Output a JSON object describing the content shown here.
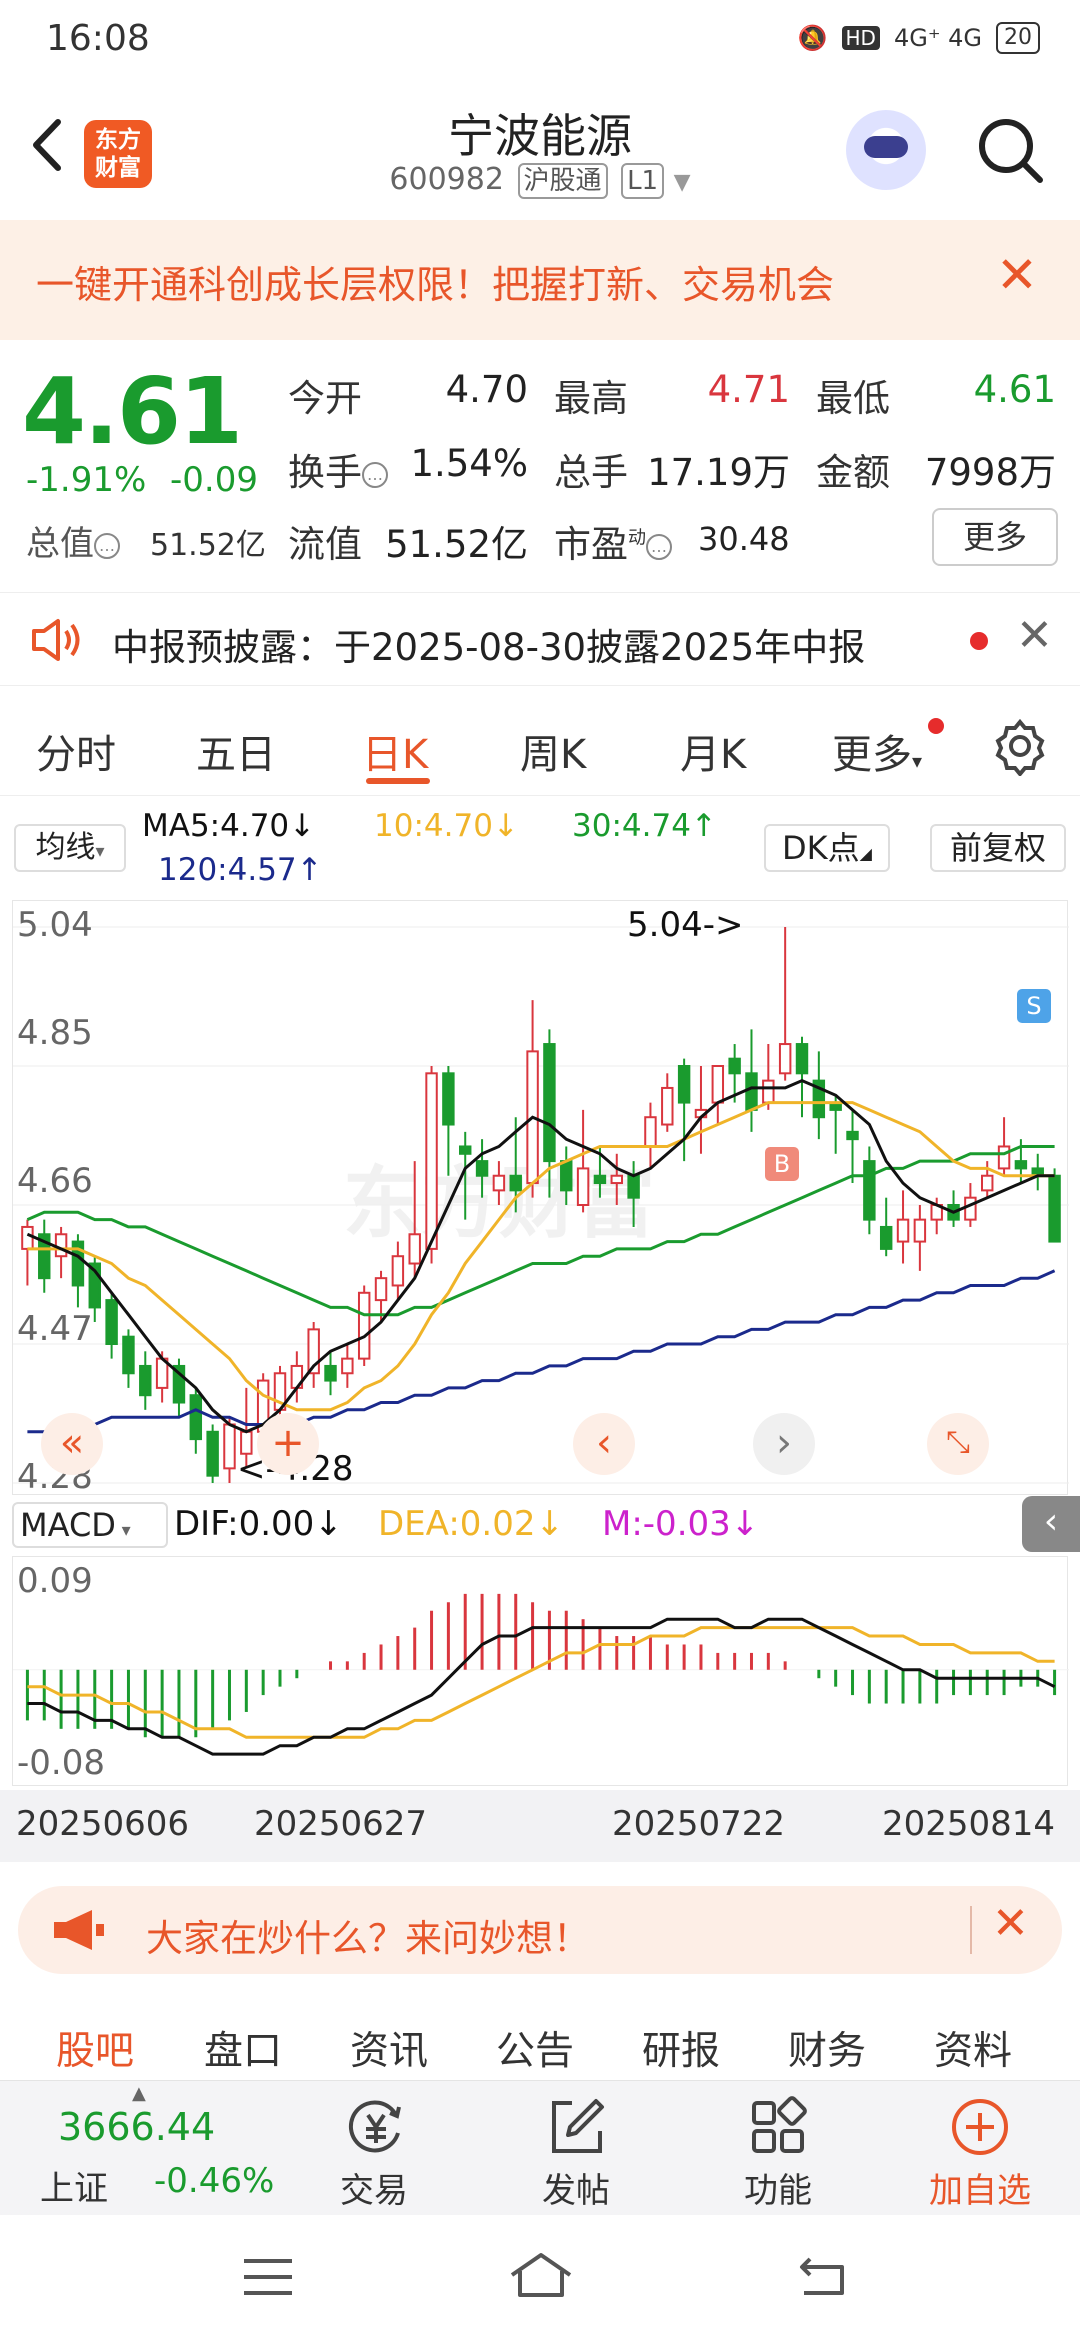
{
  "status_bar": {
    "time": "16:08",
    "network": "4G⁺ 4G",
    "hd": "HD",
    "battery": "20"
  },
  "header": {
    "logo_text": "东方财富",
    "stock_name": "宁波能源",
    "stock_code": "600982",
    "exchange_tag": "沪股通",
    "level_tag": "L1"
  },
  "banner": {
    "text": "一键开通科创成长层权限！把握打新、交易机会"
  },
  "quote": {
    "price": "4.61",
    "change_pct": "-1.91%",
    "change_abs": "-0.09",
    "open_label": "今开",
    "open": "4.70",
    "high_label": "最高",
    "high": "4.71",
    "low_label": "最低",
    "low": "4.61",
    "turnover_label": "换手",
    "turnover": "1.54%",
    "volume_label": "总手",
    "volume": "17.19万",
    "amount_label": "金额",
    "amount": "7998万",
    "mktcap_label": "总值",
    "mktcap": "51.52亿",
    "float_label": "流值",
    "float_cap": "51.52亿",
    "pe_label": "市盈",
    "pe_sup": "动",
    "pe": "30.48",
    "more_label": "更多"
  },
  "notice": {
    "text": "中报预披露：于2025-08-30披露2025年中报"
  },
  "tabs": [
    "分时",
    "五日",
    "日K",
    "周K",
    "月K",
    "更多"
  ],
  "ma": {
    "selector": "均线",
    "ma5": "MA5:4.70↓",
    "ma10": "10:4.70↓",
    "ma30": "30:4.74↑",
    "ma120": "120:4.57↑",
    "dk": "DK点",
    "fq": "前复权"
  },
  "kchart": {
    "watermark": "东方财富",
    "y_labels": [
      "5.04",
      "4.85",
      "4.66",
      "4.47",
      "4.28"
    ],
    "high_marker": "5.04->",
    "low_marker": "<-4.28",
    "buy_tag": "B",
    "sell_tag": "S"
  },
  "macd": {
    "selector": "MACD",
    "dif": "DIF:0.00↓",
    "dea": "DEA:0.02↓",
    "m": "M:-0.03↓",
    "y_top": "0.09",
    "y_bottom": "-0.08"
  },
  "dates": [
    "20250606",
    "20250627",
    "20250722",
    "20250814"
  ],
  "ask": {
    "text": "大家在炒什么？来问妙想！"
  },
  "bottom_tabs": [
    "股吧",
    "盘口",
    "资讯",
    "公告",
    "研报",
    "财务",
    "资料"
  ],
  "toolbar": {
    "index_value": "3666.44",
    "index_name": "上证",
    "index_change": "-0.46%",
    "trade": "交易",
    "post": "发帖",
    "func": "功能",
    "add": "加自选"
  },
  "colors": {
    "up": "#d9363e",
    "down": "#1a9b2e",
    "accent": "#e8562a",
    "ma5": "#111111",
    "ma10": "#f0b429",
    "ma30": "#1a9b2e",
    "ma120": "#1b2a8c",
    "dea": "#f0b429",
    "m": "#cc22cc"
  },
  "chart_data": {
    "type": "candlestick",
    "ylim": [
      4.28,
      5.04
    ],
    "candles": [
      [
        4.6,
        4.63,
        4.64,
        4.55
      ],
      [
        4.62,
        4.56,
        4.64,
        4.54
      ],
      [
        4.59,
        4.62,
        4.63,
        4.56
      ],
      [
        4.61,
        4.55,
        4.62,
        4.52
      ],
      [
        4.58,
        4.52,
        4.59,
        4.5
      ],
      [
        4.53,
        4.47,
        4.54,
        4.45
      ],
      [
        4.48,
        4.43,
        4.49,
        4.41
      ],
      [
        4.44,
        4.4,
        4.46,
        4.38
      ],
      [
        4.41,
        4.45,
        4.46,
        4.39
      ],
      [
        4.44,
        4.39,
        4.45,
        4.37
      ],
      [
        4.4,
        4.34,
        4.41,
        4.32
      ],
      [
        4.35,
        4.29,
        4.36,
        4.28
      ],
      [
        4.3,
        4.36,
        4.37,
        4.28
      ],
      [
        4.32,
        4.35,
        4.41,
        4.3
      ],
      [
        4.35,
        4.42,
        4.43,
        4.33
      ],
      [
        4.38,
        4.43,
        4.44,
        4.36
      ],
      [
        4.41,
        4.44,
        4.46,
        4.39
      ],
      [
        4.43,
        4.49,
        4.5,
        4.41
      ],
      [
        4.44,
        4.42,
        4.46,
        4.4
      ],
      [
        4.43,
        4.45,
        4.47,
        4.41
      ],
      [
        4.45,
        4.54,
        4.55,
        4.44
      ],
      [
        4.53,
        4.56,
        4.57,
        4.5
      ],
      [
        4.55,
        4.59,
        4.61,
        4.53
      ],
      [
        4.58,
        4.62,
        4.72,
        4.56
      ],
      [
        4.6,
        4.84,
        4.85,
        4.58
      ],
      [
        4.84,
        4.77,
        4.85,
        4.7
      ],
      [
        4.74,
        4.73,
        4.76,
        4.64
      ],
      [
        4.72,
        4.7,
        4.75,
        4.67
      ],
      [
        4.68,
        4.7,
        4.72,
        4.66
      ],
      [
        4.7,
        4.68,
        4.78,
        4.65
      ],
      [
        4.69,
        4.87,
        4.94,
        4.67
      ],
      [
        4.88,
        4.72,
        4.9,
        4.67
      ],
      [
        4.72,
        4.68,
        4.74,
        4.66
      ],
      [
        4.66,
        4.71,
        4.79,
        4.65
      ],
      [
        4.7,
        4.69,
        4.74,
        4.67
      ],
      [
        4.69,
        4.7,
        4.73,
        4.66
      ],
      [
        4.7,
        4.67,
        4.72,
        4.63
      ],
      [
        4.74,
        4.78,
        4.8,
        4.71
      ],
      [
        4.77,
        4.82,
        4.84,
        4.76
      ],
      [
        4.85,
        4.8,
        4.86,
        4.72
      ],
      [
        4.78,
        4.79,
        4.85,
        4.73
      ],
      [
        4.8,
        4.85,
        4.85,
        4.77
      ],
      [
        4.86,
        4.84,
        4.88,
        4.8
      ],
      [
        4.84,
        4.79,
        4.9,
        4.76
      ],
      [
        4.8,
        4.83,
        4.88,
        4.79
      ],
      [
        4.84,
        4.88,
        5.04,
        4.83
      ],
      [
        4.88,
        4.84,
        4.89,
        4.78
      ],
      [
        4.83,
        4.78,
        4.87,
        4.75
      ],
      [
        4.8,
        4.79,
        4.81,
        4.73
      ],
      [
        4.76,
        4.75,
        4.79,
        4.69
      ],
      [
        4.72,
        4.64,
        4.74,
        4.62
      ],
      [
        4.63,
        4.6,
        4.67,
        4.59
      ],
      [
        4.61,
        4.64,
        4.68,
        4.58
      ],
      [
        4.61,
        4.64,
        4.66,
        4.57
      ],
      [
        4.64,
        4.66,
        4.67,
        4.62
      ],
      [
        4.66,
        4.64,
        4.68,
        4.63
      ],
      [
        4.64,
        4.67,
        4.69,
        4.63
      ],
      [
        4.68,
        4.7,
        4.72,
        4.67
      ],
      [
        4.71,
        4.74,
        4.78,
        4.7
      ],
      [
        4.72,
        4.71,
        4.75,
        4.69
      ],
      [
        4.71,
        4.7,
        4.73,
        4.68
      ],
      [
        4.7,
        4.61,
        4.71,
        4.61
      ]
    ],
    "ma5": [
      4.62,
      4.61,
      4.6,
      4.59,
      4.57,
      4.54,
      4.51,
      4.48,
      4.45,
      4.43,
      4.41,
      4.38,
      4.36,
      4.35,
      4.36,
      4.38,
      4.41,
      4.44,
      4.46,
      4.47,
      4.48,
      4.5,
      4.53,
      4.56,
      4.61,
      4.66,
      4.71,
      4.73,
      4.74,
      4.76,
      4.78,
      4.77,
      4.75,
      4.74,
      4.73,
      4.71,
      4.7,
      4.71,
      4.73,
      4.75,
      4.78,
      4.8,
      4.81,
      4.82,
      4.82,
      4.82,
      4.83,
      4.82,
      4.81,
      4.79,
      4.77,
      4.72,
      4.69,
      4.67,
      4.66,
      4.65,
      4.66,
      4.67,
      4.68,
      4.69,
      4.7,
      4.7
    ],
    "ma10": [
      4.6,
      4.6,
      4.6,
      4.6,
      4.59,
      4.58,
      4.56,
      4.55,
      4.53,
      4.51,
      4.49,
      4.47,
      4.45,
      4.42,
      4.4,
      4.39,
      4.38,
      4.38,
      4.38,
      4.39,
      4.41,
      4.42,
      4.44,
      4.47,
      4.51,
      4.54,
      4.58,
      4.61,
      4.64,
      4.67,
      4.69,
      4.71,
      4.72,
      4.73,
      4.74,
      4.74,
      4.74,
      4.74,
      4.74,
      4.75,
      4.76,
      4.77,
      4.78,
      4.79,
      4.8,
      4.8,
      4.8,
      4.8,
      4.8,
      4.8,
      4.79,
      4.78,
      4.77,
      4.76,
      4.74,
      4.72,
      4.71,
      4.71,
      4.7,
      4.7,
      4.7,
      4.7
    ],
    "ma30": [
      4.64,
      4.65,
      4.65,
      4.65,
      4.64,
      4.64,
      4.63,
      4.63,
      4.62,
      4.61,
      4.6,
      4.59,
      4.58,
      4.57,
      4.56,
      4.55,
      4.54,
      4.53,
      4.52,
      4.52,
      4.51,
      4.51,
      4.51,
      4.52,
      4.52,
      4.53,
      4.54,
      4.55,
      4.56,
      4.57,
      4.58,
      4.58,
      4.58,
      4.59,
      4.59,
      4.6,
      4.6,
      4.6,
      4.61,
      4.61,
      4.62,
      4.62,
      4.63,
      4.64,
      4.65,
      4.66,
      4.67,
      4.68,
      4.69,
      4.7,
      4.7,
      4.71,
      4.71,
      4.72,
      4.72,
      4.72,
      4.73,
      4.73,
      4.73,
      4.74,
      4.74,
      4.74
    ],
    "ma120": [
      4.35,
      4.35,
      4.36,
      4.36,
      4.36,
      4.37,
      4.37,
      4.37,
      4.37,
      4.37,
      4.38,
      4.37,
      4.37,
      4.36,
      4.36,
      4.36,
      4.36,
      4.37,
      4.37,
      4.38,
      4.38,
      4.39,
      4.39,
      4.4,
      4.4,
      4.41,
      4.41,
      4.42,
      4.42,
      4.43,
      4.43,
      4.44,
      4.44,
      4.45,
      4.45,
      4.45,
      4.46,
      4.46,
      4.47,
      4.47,
      4.47,
      4.48,
      4.48,
      4.49,
      4.49,
      4.5,
      4.5,
      4.5,
      4.51,
      4.51,
      4.52,
      4.52,
      4.53,
      4.53,
      4.54,
      4.54,
      4.55,
      4.55,
      4.55,
      4.56,
      4.56,
      4.57
    ],
    "macd_m": [
      -0.06,
      -0.06,
      -0.07,
      -0.07,
      -0.07,
      -0.07,
      -0.07,
      -0.08,
      -0.08,
      -0.08,
      -0.08,
      -0.07,
      -0.06,
      -0.05,
      -0.03,
      -0.02,
      -0.01,
      0.0,
      0.01,
      0.01,
      0.02,
      0.03,
      0.04,
      0.05,
      0.07,
      0.08,
      0.09,
      0.09,
      0.09,
      0.09,
      0.08,
      0.07,
      0.07,
      0.06,
      0.05,
      0.04,
      0.04,
      0.04,
      0.03,
      0.03,
      0.03,
      0.02,
      0.02,
      0.02,
      0.02,
      0.01,
      0.0,
      -0.01,
      -0.02,
      -0.03,
      -0.04,
      -0.04,
      -0.04,
      -0.04,
      -0.04,
      -0.03,
      -0.03,
      -0.03,
      -0.03,
      -0.02,
      -0.02,
      -0.03
    ],
    "macd_dif": [
      -0.04,
      -0.04,
      -0.05,
      -0.05,
      -0.06,
      -0.06,
      -0.07,
      -0.07,
      -0.08,
      -0.08,
      -0.09,
      -0.1,
      -0.1,
      -0.1,
      -0.1,
      -0.09,
      -0.09,
      -0.08,
      -0.08,
      -0.07,
      -0.07,
      -0.06,
      -0.05,
      -0.04,
      -0.03,
      -0.01,
      0.01,
      0.03,
      0.04,
      0.04,
      0.05,
      0.05,
      0.05,
      0.05,
      0.05,
      0.05,
      0.05,
      0.05,
      0.06,
      0.06,
      0.06,
      0.06,
      0.05,
      0.05,
      0.06,
      0.06,
      0.06,
      0.05,
      0.04,
      0.03,
      0.02,
      0.01,
      0.0,
      0.0,
      -0.01,
      -0.01,
      -0.01,
      -0.01,
      -0.01,
      -0.01,
      -0.01,
      -0.02
    ],
    "macd_dea": [
      -0.02,
      -0.02,
      -0.03,
      -0.03,
      -0.03,
      -0.04,
      -0.04,
      -0.05,
      -0.05,
      -0.06,
      -0.07,
      -0.07,
      -0.07,
      -0.08,
      -0.08,
      -0.08,
      -0.08,
      -0.08,
      -0.08,
      -0.08,
      -0.08,
      -0.07,
      -0.07,
      -0.06,
      -0.06,
      -0.05,
      -0.04,
      -0.03,
      -0.02,
      -0.01,
      0.0,
      0.01,
      0.02,
      0.02,
      0.03,
      0.03,
      0.03,
      0.04,
      0.04,
      0.04,
      0.05,
      0.05,
      0.05,
      0.05,
      0.05,
      0.05,
      0.05,
      0.05,
      0.05,
      0.05,
      0.04,
      0.04,
      0.04,
      0.03,
      0.03,
      0.03,
      0.02,
      0.02,
      0.02,
      0.02,
      0.01,
      0.01
    ]
  }
}
